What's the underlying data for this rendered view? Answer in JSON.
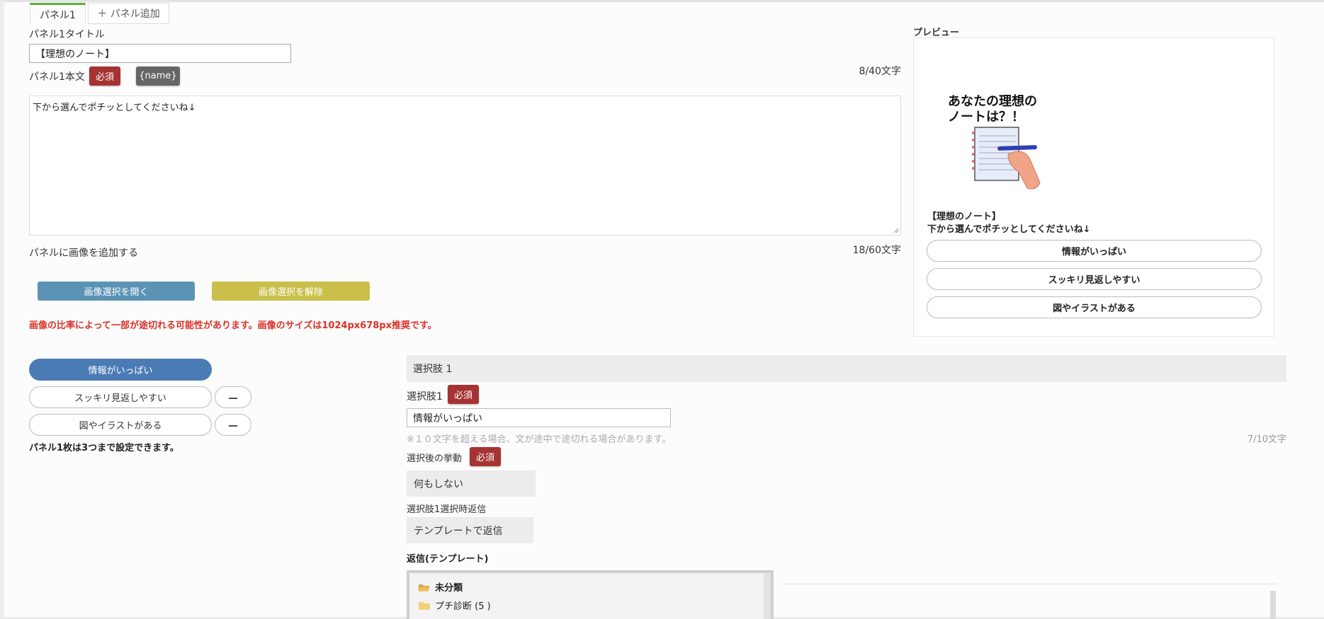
{
  "tabs": [
    {
      "label": "パネル1"
    },
    {
      "label": "＋ パネル追加"
    }
  ],
  "panel": {
    "title_label": "パネル1タイトル",
    "title_value": "【理想のノート】",
    "body_label": "パネル1本文",
    "required_badge": "必須",
    "name_badge": "{name}",
    "title_counter": "8/40文字",
    "body_value": "下から選んでポチッとしてくださいね↓",
    "body_counter": "18/60文字",
    "image_label": "パネルに画像を追加する",
    "open_image_button": "画像選択を開く",
    "clear_image_button": "画像選択を解除",
    "image_warning": "画像の比率によって一部が途切れる可能性があります。画像のサイズは1024px678px推奨です。"
  },
  "preview": {
    "heading": "プレビュー",
    "image_text_line1": "あなたの理想の",
    "image_text_line2": "ノートは？！",
    "title": "【理想のノート】",
    "body": "下から選んでポチッとしてくださいね↓",
    "buttons": [
      "情報がいっぱい",
      "スッキリ見返しやすい",
      "図やイラストがある"
    ]
  },
  "choices": {
    "items": [
      "情報がいっぱい",
      "スッキリ見返しやすい",
      "図やイラストがある"
    ],
    "minus_label": "－",
    "limit_note": "パネル1枚は3つまで設定できます。"
  },
  "choice_detail": {
    "section_title": "選択肢 1",
    "choice_label": "選択肢1",
    "required_badge": "必須",
    "choice_value": "情報がいっぱい",
    "choice_note": "※１０文字を超える場合、文が途中で途切れる場合があります。",
    "choice_counter": "7/10文字",
    "behavior_label": "選択後の挙動",
    "behavior_value": "何もしない",
    "reply_label": "選択肢1選択時返信",
    "reply_value": "テンプレートで返信",
    "template_label": "返信(テンプレート)",
    "folders": [
      {
        "name": "未分類",
        "open": true
      },
      {
        "name": "プチ診断 (5 )",
        "open": false
      }
    ]
  },
  "colors": {
    "primary_blue": "#4a7bb5",
    "required_red": "#a63232",
    "open_button": "#5b93b5",
    "clear_button": "#c9bf4a",
    "warning_red": "#d9322a",
    "tab_accent": "#5fae3f"
  }
}
